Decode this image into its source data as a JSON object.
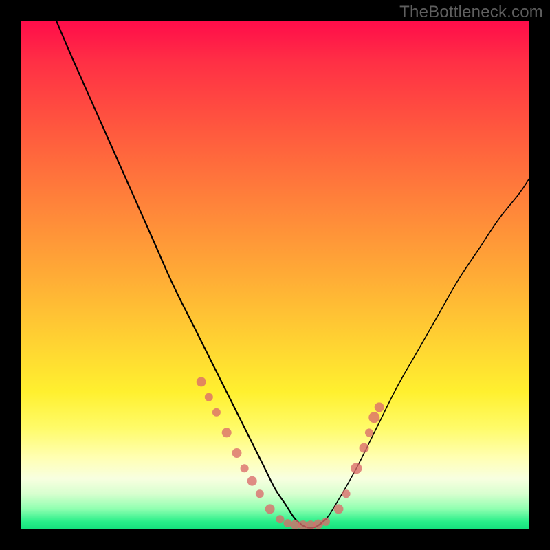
{
  "watermark": "TheBottleneck.com",
  "colors": {
    "marker": "#da6a6a",
    "curve": "#000000"
  },
  "chart_data": {
    "type": "line",
    "title": "",
    "xlabel": "",
    "ylabel": "",
    "xlim": [
      0,
      100
    ],
    "ylim": [
      0,
      100
    ],
    "grid": false,
    "legend": false,
    "series": [
      {
        "name": "bottleneck-curve",
        "x": [
          7,
          10,
          14,
          18,
          22,
          26,
          30,
          34,
          38,
          42,
          46,
          48,
          50,
          52,
          54,
          56,
          58,
          60,
          62,
          66,
          70,
          74,
          78,
          82,
          86,
          90,
          94,
          98,
          100
        ],
        "y": [
          100,
          93,
          84,
          75,
          66,
          57,
          48,
          40,
          32,
          24,
          16,
          12,
          8,
          5,
          2,
          0.5,
          0.5,
          2,
          5,
          12,
          20,
          28,
          35,
          42,
          49,
          55,
          61,
          66,
          69
        ]
      }
    ],
    "markers": {
      "name": "highlighted-points",
      "x": [
        35.5,
        37.0,
        38.5,
        40.5,
        42.5,
        44.0,
        45.5,
        47.0,
        49.0,
        51.0,
        52.5,
        54.0,
        55.5,
        57.0,
        58.5,
        60.0,
        62.5,
        64.0,
        66.0,
        67.5,
        68.5,
        69.5,
        70.5
      ],
      "y": [
        29.0,
        26.0,
        23.0,
        19.0,
        15.0,
        12.0,
        9.5,
        7.0,
        4.0,
        2.0,
        1.2,
        0.9,
        0.8,
        0.8,
        1.0,
        1.5,
        4.0,
        7.0,
        12.0,
        16.0,
        19.0,
        22.0,
        24.0
      ],
      "r": [
        7,
        6,
        6,
        7,
        7,
        6,
        7,
        6,
        7,
        6,
        6,
        7,
        7,
        7,
        7,
        6,
        7,
        6,
        8,
        7,
        6,
        8,
        7
      ]
    }
  }
}
